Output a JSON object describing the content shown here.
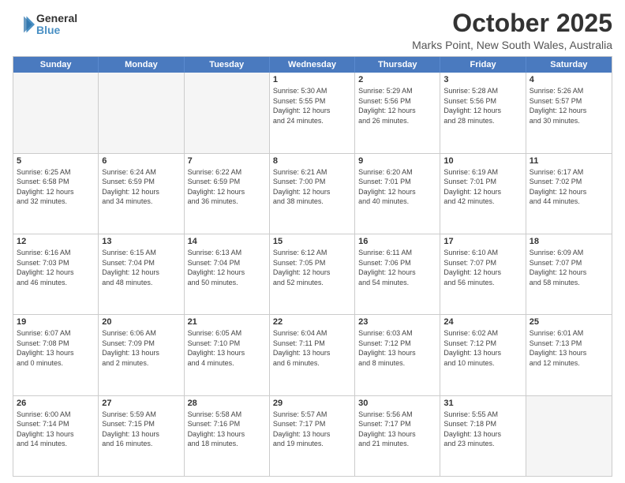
{
  "logo": {
    "general": "General",
    "blue": "Blue"
  },
  "header": {
    "month": "October 2025",
    "location": "Marks Point, New South Wales, Australia"
  },
  "weekdays": [
    "Sunday",
    "Monday",
    "Tuesday",
    "Wednesday",
    "Thursday",
    "Friday",
    "Saturday"
  ],
  "rows": [
    [
      {
        "date": "",
        "info": ""
      },
      {
        "date": "",
        "info": ""
      },
      {
        "date": "",
        "info": ""
      },
      {
        "date": "1",
        "info": "Sunrise: 5:30 AM\nSunset: 5:55 PM\nDaylight: 12 hours\nand 24 minutes."
      },
      {
        "date": "2",
        "info": "Sunrise: 5:29 AM\nSunset: 5:56 PM\nDaylight: 12 hours\nand 26 minutes."
      },
      {
        "date": "3",
        "info": "Sunrise: 5:28 AM\nSunset: 5:56 PM\nDaylight: 12 hours\nand 28 minutes."
      },
      {
        "date": "4",
        "info": "Sunrise: 5:26 AM\nSunset: 5:57 PM\nDaylight: 12 hours\nand 30 minutes."
      }
    ],
    [
      {
        "date": "5",
        "info": "Sunrise: 6:25 AM\nSunset: 6:58 PM\nDaylight: 12 hours\nand 32 minutes."
      },
      {
        "date": "6",
        "info": "Sunrise: 6:24 AM\nSunset: 6:59 PM\nDaylight: 12 hours\nand 34 minutes."
      },
      {
        "date": "7",
        "info": "Sunrise: 6:22 AM\nSunset: 6:59 PM\nDaylight: 12 hours\nand 36 minutes."
      },
      {
        "date": "8",
        "info": "Sunrise: 6:21 AM\nSunset: 7:00 PM\nDaylight: 12 hours\nand 38 minutes."
      },
      {
        "date": "9",
        "info": "Sunrise: 6:20 AM\nSunset: 7:01 PM\nDaylight: 12 hours\nand 40 minutes."
      },
      {
        "date": "10",
        "info": "Sunrise: 6:19 AM\nSunset: 7:01 PM\nDaylight: 12 hours\nand 42 minutes."
      },
      {
        "date": "11",
        "info": "Sunrise: 6:17 AM\nSunset: 7:02 PM\nDaylight: 12 hours\nand 44 minutes."
      }
    ],
    [
      {
        "date": "12",
        "info": "Sunrise: 6:16 AM\nSunset: 7:03 PM\nDaylight: 12 hours\nand 46 minutes."
      },
      {
        "date": "13",
        "info": "Sunrise: 6:15 AM\nSunset: 7:04 PM\nDaylight: 12 hours\nand 48 minutes."
      },
      {
        "date": "14",
        "info": "Sunrise: 6:13 AM\nSunset: 7:04 PM\nDaylight: 12 hours\nand 50 minutes."
      },
      {
        "date": "15",
        "info": "Sunrise: 6:12 AM\nSunset: 7:05 PM\nDaylight: 12 hours\nand 52 minutes."
      },
      {
        "date": "16",
        "info": "Sunrise: 6:11 AM\nSunset: 7:06 PM\nDaylight: 12 hours\nand 54 minutes."
      },
      {
        "date": "17",
        "info": "Sunrise: 6:10 AM\nSunset: 7:07 PM\nDaylight: 12 hours\nand 56 minutes."
      },
      {
        "date": "18",
        "info": "Sunrise: 6:09 AM\nSunset: 7:07 PM\nDaylight: 12 hours\nand 58 minutes."
      }
    ],
    [
      {
        "date": "19",
        "info": "Sunrise: 6:07 AM\nSunset: 7:08 PM\nDaylight: 13 hours\nand 0 minutes."
      },
      {
        "date": "20",
        "info": "Sunrise: 6:06 AM\nSunset: 7:09 PM\nDaylight: 13 hours\nand 2 minutes."
      },
      {
        "date": "21",
        "info": "Sunrise: 6:05 AM\nSunset: 7:10 PM\nDaylight: 13 hours\nand 4 minutes."
      },
      {
        "date": "22",
        "info": "Sunrise: 6:04 AM\nSunset: 7:11 PM\nDaylight: 13 hours\nand 6 minutes."
      },
      {
        "date": "23",
        "info": "Sunrise: 6:03 AM\nSunset: 7:12 PM\nDaylight: 13 hours\nand 8 minutes."
      },
      {
        "date": "24",
        "info": "Sunrise: 6:02 AM\nSunset: 7:12 PM\nDaylight: 13 hours\nand 10 minutes."
      },
      {
        "date": "25",
        "info": "Sunrise: 6:01 AM\nSunset: 7:13 PM\nDaylight: 13 hours\nand 12 minutes."
      }
    ],
    [
      {
        "date": "26",
        "info": "Sunrise: 6:00 AM\nSunset: 7:14 PM\nDaylight: 13 hours\nand 14 minutes."
      },
      {
        "date": "27",
        "info": "Sunrise: 5:59 AM\nSunset: 7:15 PM\nDaylight: 13 hours\nand 16 minutes."
      },
      {
        "date": "28",
        "info": "Sunrise: 5:58 AM\nSunset: 7:16 PM\nDaylight: 13 hours\nand 18 minutes."
      },
      {
        "date": "29",
        "info": "Sunrise: 5:57 AM\nSunset: 7:17 PM\nDaylight: 13 hours\nand 19 minutes."
      },
      {
        "date": "30",
        "info": "Sunrise: 5:56 AM\nSunset: 7:17 PM\nDaylight: 13 hours\nand 21 minutes."
      },
      {
        "date": "31",
        "info": "Sunrise: 5:55 AM\nSunset: 7:18 PM\nDaylight: 13 hours\nand 23 minutes."
      },
      {
        "date": "",
        "info": ""
      }
    ]
  ]
}
